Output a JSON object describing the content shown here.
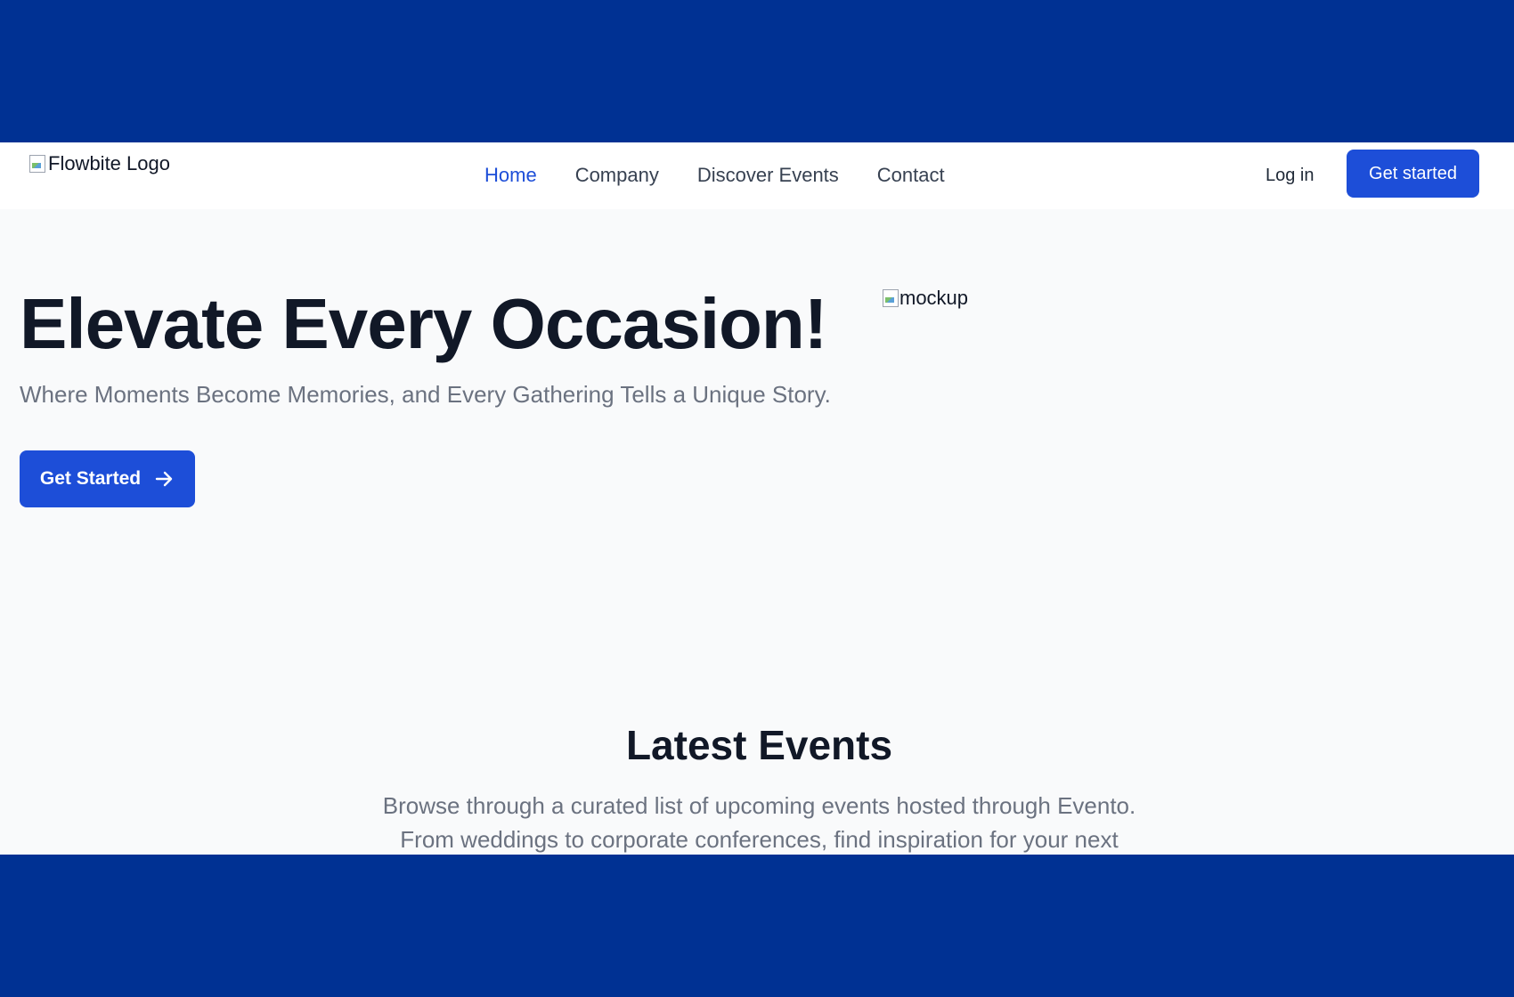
{
  "navbar": {
    "logo_alt": "Flowbite Logo",
    "links": [
      {
        "label": "Home",
        "active": true
      },
      {
        "label": "Company",
        "active": false
      },
      {
        "label": "Discover Events",
        "active": false
      },
      {
        "label": "Contact",
        "active": false
      }
    ],
    "login_label": "Log in",
    "cta_label": "Get started"
  },
  "hero": {
    "title": "Elevate Every Occasion!",
    "subtitle": "Where Moments Become Memories, and Every Gathering Tells a Unique Story.",
    "cta_label": "Get Started",
    "mockup_alt": "mockup"
  },
  "latest_events": {
    "title": "Latest Events",
    "description": "Browse through a curated list of upcoming events hosted through Evento. From weddings to corporate conferences, find inspiration for your next"
  },
  "colors": {
    "frame": "#003193",
    "accent": "#1d4ed8",
    "page_bg": "#f9fafb",
    "heading": "#111827",
    "muted": "#6b7280"
  },
  "icons": {
    "cta_arrow": "arrow-right-icon",
    "broken_image": "broken-image-icon"
  }
}
